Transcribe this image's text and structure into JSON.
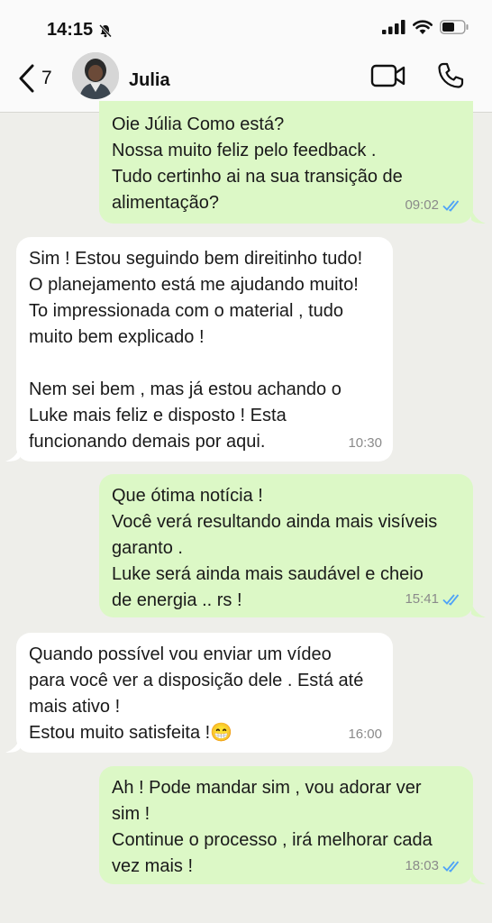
{
  "status_bar": {
    "time": "14:15"
  },
  "header": {
    "back_count": "7",
    "contact_name": "Julia"
  },
  "messages": [
    {
      "direction": "outgoing",
      "text": "Oie Júlia Como está?\nNossa muito feliz pelo feedback .\nTudo certinho ai na sua transição de\nalimentação?",
      "time": "09:02",
      "read": true
    },
    {
      "direction": "incoming",
      "text": "Sim ! Estou seguindo bem direitinho tudo!\nO planejamento está me ajudando muito!\nTo impressionada com o material , tudo\nmuito bem explicado !\n\nNem sei bem , mas já estou achando o\nLuke mais feliz e disposto ! Esta\nfuncionando demais por aqui.",
      "time": "10:30"
    },
    {
      "direction": "outgoing",
      "text": "Que ótima notícia !\nVocê verá resultando ainda mais visíveis\ngaranto .\nLuke será ainda mais saudável e cheio\nde energia .. rs !",
      "time": "15:41",
      "read": true
    },
    {
      "direction": "incoming",
      "text": "Quando possível vou enviar um vídeo\npara você ver a disposição dele . Está até\nmais ativo !\nEstou muito satisfeita !",
      "emoji": "😁",
      "time": "16:00"
    },
    {
      "direction": "outgoing",
      "text": "Ah ! Pode mandar sim , vou adorar ver\nsim !\nContinue o processo , irá melhorar cada\nvez mais !",
      "time": "18:03",
      "read": true
    }
  ],
  "colors": {
    "outgoing_bubble": "#dcf8c6",
    "incoming_bubble": "#ffffff",
    "read_ticks": "#4fa3f7",
    "background": "#eeeeea"
  },
  "icons": [
    "bell-slash-icon",
    "signal-icon",
    "wifi-icon",
    "battery-icon",
    "chevron-left-icon",
    "video-call-icon",
    "phone-icon",
    "double-check-icon"
  ]
}
